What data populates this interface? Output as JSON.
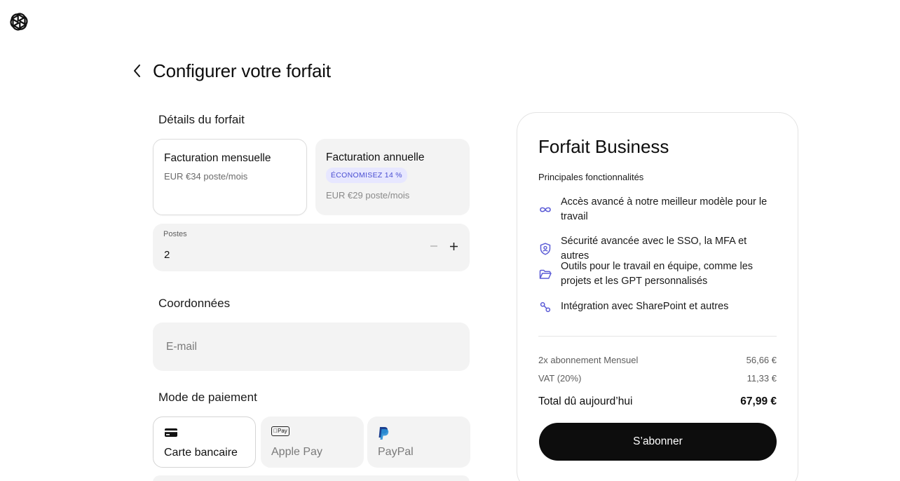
{
  "header": {
    "title": "Configurer votre forfait"
  },
  "plan_details": {
    "heading": "Détails du forfait",
    "monthly": {
      "title": "Facturation mensuelle",
      "price": "EUR €34 poste/mois"
    },
    "annual": {
      "title": "Facturation annuelle",
      "badge": "ÉCONOMISEZ 14 %",
      "price": "EUR €29 poste/mois"
    },
    "seats": {
      "label": "Postes",
      "value": "2",
      "decrement": "−",
      "increment": "+"
    }
  },
  "contact": {
    "heading": "Coordonnées",
    "email_placeholder": "E-mail",
    "email_value": ""
  },
  "payment": {
    "heading": "Mode de paiement",
    "methods": [
      {
        "label": "Carte bancaire",
        "icon": "credit-card-icon"
      },
      {
        "label": "Apple Pay",
        "icon": "apple-pay-icon",
        "mark": "Pay"
      },
      {
        "label": "PayPal",
        "icon": "paypal-icon"
      }
    ]
  },
  "summary": {
    "title": "Forfait Business",
    "features_heading": "Principales fonctionnalités",
    "features": [
      {
        "text": "Accès avancé à notre meilleur modèle pour le travail",
        "icon": "infinity-icon"
      },
      {
        "text": "Sécurité avancée avec le SSO, la MFA et autres",
        "icon": "shield-user-icon"
      },
      {
        "text": "Outils pour le travail en équipe, comme les projets et les GPT personnalisés",
        "icon": "folder-icon"
      },
      {
        "text": "Intégration avec SharePoint et autres",
        "icon": "link-icon"
      }
    ],
    "lines": [
      {
        "label": "2x abonnement Mensuel",
        "amount": "56,66 €"
      },
      {
        "label": "VAT (20%)",
        "amount": "11,33 €"
      }
    ],
    "total": {
      "label": "Total dû aujourd’hui",
      "amount": "67,99 €"
    },
    "subscribe_label": "S’abonner"
  },
  "colors": {
    "accent_icon": "#5b5bd6",
    "badge_bg": "#e7e7ff",
    "badge_text": "#4a4ed1",
    "button_bg": "#0d0d0d"
  }
}
